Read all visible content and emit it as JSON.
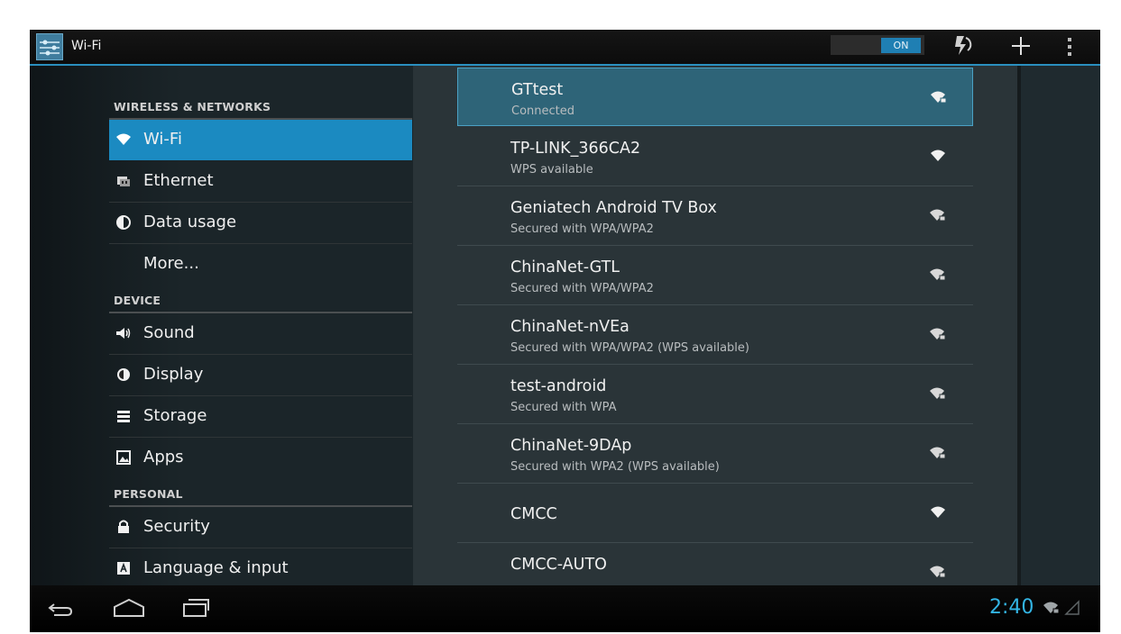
{
  "app": {
    "title": "Wi-Fi",
    "icon": "settings-sliders-icon"
  },
  "action_bar": {
    "toggle_label": "ON",
    "toggle_state": "on",
    "scan_icon": "wps-scan-icon",
    "add_icon": "add-network-icon",
    "overflow_icon": "overflow-menu-icon"
  },
  "sidebar": {
    "section_wireless": "WIRELESS & NETWORKS",
    "section_device": "DEVICE",
    "section_personal": "PERSONAL",
    "items": [
      {
        "label": "Wi-Fi",
        "icon": "wifi-icon",
        "selected": true
      },
      {
        "label": "Ethernet",
        "icon": "ethernet-icon"
      },
      {
        "label": "Data usage",
        "icon": "data-usage-icon"
      },
      {
        "label": "More...",
        "icon": ""
      },
      {
        "label": "Sound",
        "icon": "sound-icon"
      },
      {
        "label": "Display",
        "icon": "display-icon"
      },
      {
        "label": "Storage",
        "icon": "storage-icon"
      },
      {
        "label": "Apps",
        "icon": "apps-icon"
      },
      {
        "label": "Security",
        "icon": "lock-icon"
      },
      {
        "label": "Language & input",
        "icon": "language-icon"
      }
    ]
  },
  "networks": [
    {
      "ssid": "GTtest",
      "status": "Connected",
      "secured": true,
      "connected": true
    },
    {
      "ssid": "TP-LINK_366CA2",
      "status": "WPS available",
      "secured": false
    },
    {
      "ssid": "Geniatech Android TV Box",
      "status": "Secured with WPA/WPA2",
      "secured": true
    },
    {
      "ssid": "ChinaNet-GTL",
      "status": "Secured with WPA/WPA2",
      "secured": true
    },
    {
      "ssid": "ChinaNet-nVEa",
      "status": "Secured with WPA/WPA2 (WPS available)",
      "secured": true
    },
    {
      "ssid": "test-android",
      "status": "Secured with WPA",
      "secured": true
    },
    {
      "ssid": "ChinaNet-9DAp",
      "status": "Secured with WPA2 (WPS available)",
      "secured": true
    },
    {
      "ssid": "CMCC",
      "status": "",
      "secured": false
    },
    {
      "ssid": "CMCC-AUTO",
      "status": "",
      "secured": true
    }
  ],
  "system_bar": {
    "clock": "2:40",
    "back_icon": "back-icon",
    "home_icon": "home-icon",
    "recents_icon": "recents-icon"
  },
  "colors": {
    "accent": "#33b5e5",
    "selected": "#1b8ac1",
    "toggle_on": "#1f7fb3"
  }
}
